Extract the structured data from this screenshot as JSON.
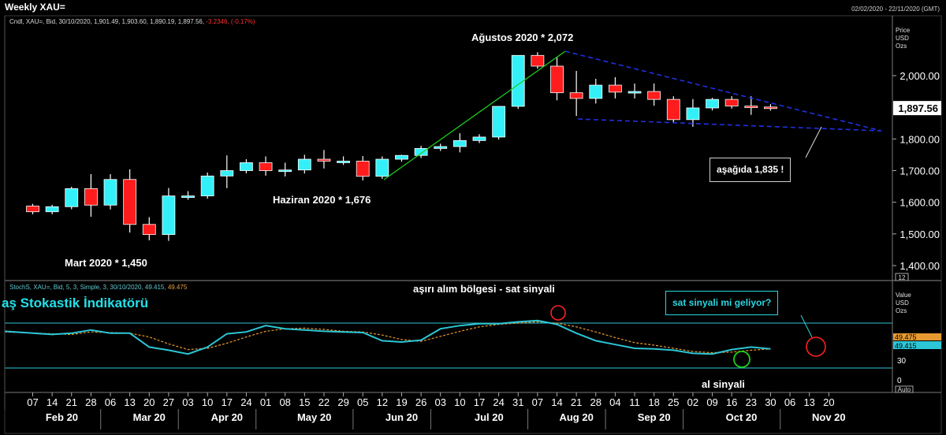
{
  "window": {
    "title": "Weekly XAU=",
    "date_range": "02/02/2020 - 22/11/2020 (GMT)"
  },
  "price_panel": {
    "info_prefix": "Cndl, XAU=, Bid, 30/10/2020, 1,901.49, 1,903.60, 1,890.19, 1,897.56,",
    "info_change": "-3.2346, (-0.17%)",
    "unit_label": [
      "Price",
      "USD",
      "Ozs"
    ],
    "last_price_label": "1,897.56",
    "zoom_badge": "12"
  },
  "stoch_panel": {
    "info_prefix": "StochS, XAU=, Bid, 5, 3, Simple, 3, 30/10/2020, 49.415,",
    "info_orange": "49.475",
    "unit_label": [
      "Value",
      "USD",
      "Ozs"
    ],
    "value_orange_label": "49.475",
    "value_cyan_label": "49.415",
    "auto_badge": "Auto",
    "indicator_title": "aş Stokastik İndikatörü"
  },
  "annotations": {
    "mart": "Mart 2020 * 1,450",
    "haziran": "Haziran 2020 * 1,676",
    "agustos": "Ağustos 2020 * 2,072",
    "asagida": "aşağıda 1,835 !",
    "asiri_alim": "aşırı alım bölgesi - sat sinyali",
    "sat_sinyali": "sat sinyali mi geliyor?",
    "al_sinyali": "al sinyali"
  },
  "colors": {
    "up": "#33f0f8",
    "down": "#ff1c1c",
    "stoch_k": "#2cc6d6",
    "stoch_d": "#e89a30",
    "trend_up": "#1ccf1c",
    "trend_down": "#2030e0"
  },
  "chart_data": [
    {
      "type": "candlestick",
      "title": "Weekly XAU=",
      "ylabel": "Price USD Ozs",
      "ylim": [
        1350,
        2100
      ],
      "y_ticks": [
        "1,400.00",
        "1,500.00",
        "1,600.00",
        "1,700.00",
        "1,800.00",
        "2,000.00"
      ],
      "x_ticks": [
        "07",
        "14",
        "21",
        "28",
        "06",
        "13",
        "20",
        "27",
        "03",
        "10",
        "17",
        "24",
        "01",
        "08",
        "15",
        "22",
        "29",
        "05",
        "12",
        "19",
        "26",
        "03",
        "10",
        "17",
        "24",
        "31",
        "07",
        "14",
        "21",
        "28",
        "04",
        "11",
        "18",
        "25",
        "02",
        "09",
        "16",
        "23",
        "30",
        "06",
        "13",
        "20"
      ],
      "months": [
        "Feb 20",
        "Mar 20",
        "Apr 20",
        "May 20",
        "Jun 20",
        "Jul 20",
        "Aug 20",
        "Sep 20",
        "Oct 20",
        "Nov 20"
      ],
      "series": [
        {
          "weeks": [
            "07/02",
            "14/02",
            "21/02",
            "28/02",
            "06/03",
            "13/03",
            "20/03",
            "27/03",
            "03/04",
            "10/04",
            "17/04",
            "24/04",
            "01/05",
            "08/05",
            "15/05",
            "22/05",
            "29/05",
            "05/06",
            "12/06",
            "19/06",
            "26/06",
            "03/07",
            "10/07",
            "17/07",
            "24/07",
            "31/07",
            "07/08",
            "14/08",
            "21/08",
            "28/08",
            "04/09",
            "11/09",
            "18/09",
            "25/09",
            "02/10",
            "09/10",
            "16/10",
            "23/10",
            "30/10"
          ],
          "open": [
            1588,
            1570,
            1586,
            1643,
            1591,
            1672,
            1530,
            1498,
            1620,
            1620,
            1683,
            1700,
            1725,
            1700,
            1702,
            1736,
            1730,
            1730,
            1682,
            1736,
            1748,
            1770,
            1776,
            1795,
            1806,
            1903,
            2064,
            2030,
            1946,
            1928,
            1970,
            1948,
            1950,
            1925,
            1861,
            1898,
            1925,
            1904,
            1901
          ],
          "high": [
            1595,
            1592,
            1649,
            1689,
            1689,
            1704,
            1553,
            1645,
            1635,
            1694,
            1748,
            1736,
            1745,
            1725,
            1750,
            1765,
            1745,
            1746,
            1745,
            1750,
            1778,
            1785,
            1818,
            1815,
            1820,
            1975,
            2074,
            2060,
            2015,
            1990,
            1995,
            1975,
            1975,
            1935,
            1926,
            1930,
            1935,
            1935,
            1910
          ]
        }
      ]
    },
    {
      "type": "line",
      "title": "StochS, XAU=, Bid, 5, 3, Simple, 3",
      "ylabel": "Value USD Ozs",
      "ylim": [
        0,
        100
      ],
      "y_ticks": [
        "0",
        "30"
      ],
      "series": [
        {
          "name": "49.415",
          "values": [
            77,
            72,
            74,
            79,
            74,
            74,
            52,
            47,
            41,
            52,
            73,
            76,
            86,
            81,
            79,
            77,
            76,
            75,
            62,
            60,
            63,
            81,
            86,
            89,
            89,
            92,
            94,
            88,
            74,
            62,
            56,
            50,
            49,
            47,
            42,
            41,
            48,
            52,
            49
          ]
        },
        {
          "name": "49.475",
          "values": [
            76,
            73,
            72,
            76,
            75,
            74,
            68,
            57,
            48,
            50,
            58,
            68,
            77,
            81,
            82,
            80,
            77,
            76,
            71,
            64,
            61,
            69,
            77,
            84,
            88,
            90,
            92,
            90,
            84,
            76,
            67,
            59,
            55,
            50,
            45,
            43,
            44,
            47,
            49
          ]
        }
      ]
    }
  ]
}
